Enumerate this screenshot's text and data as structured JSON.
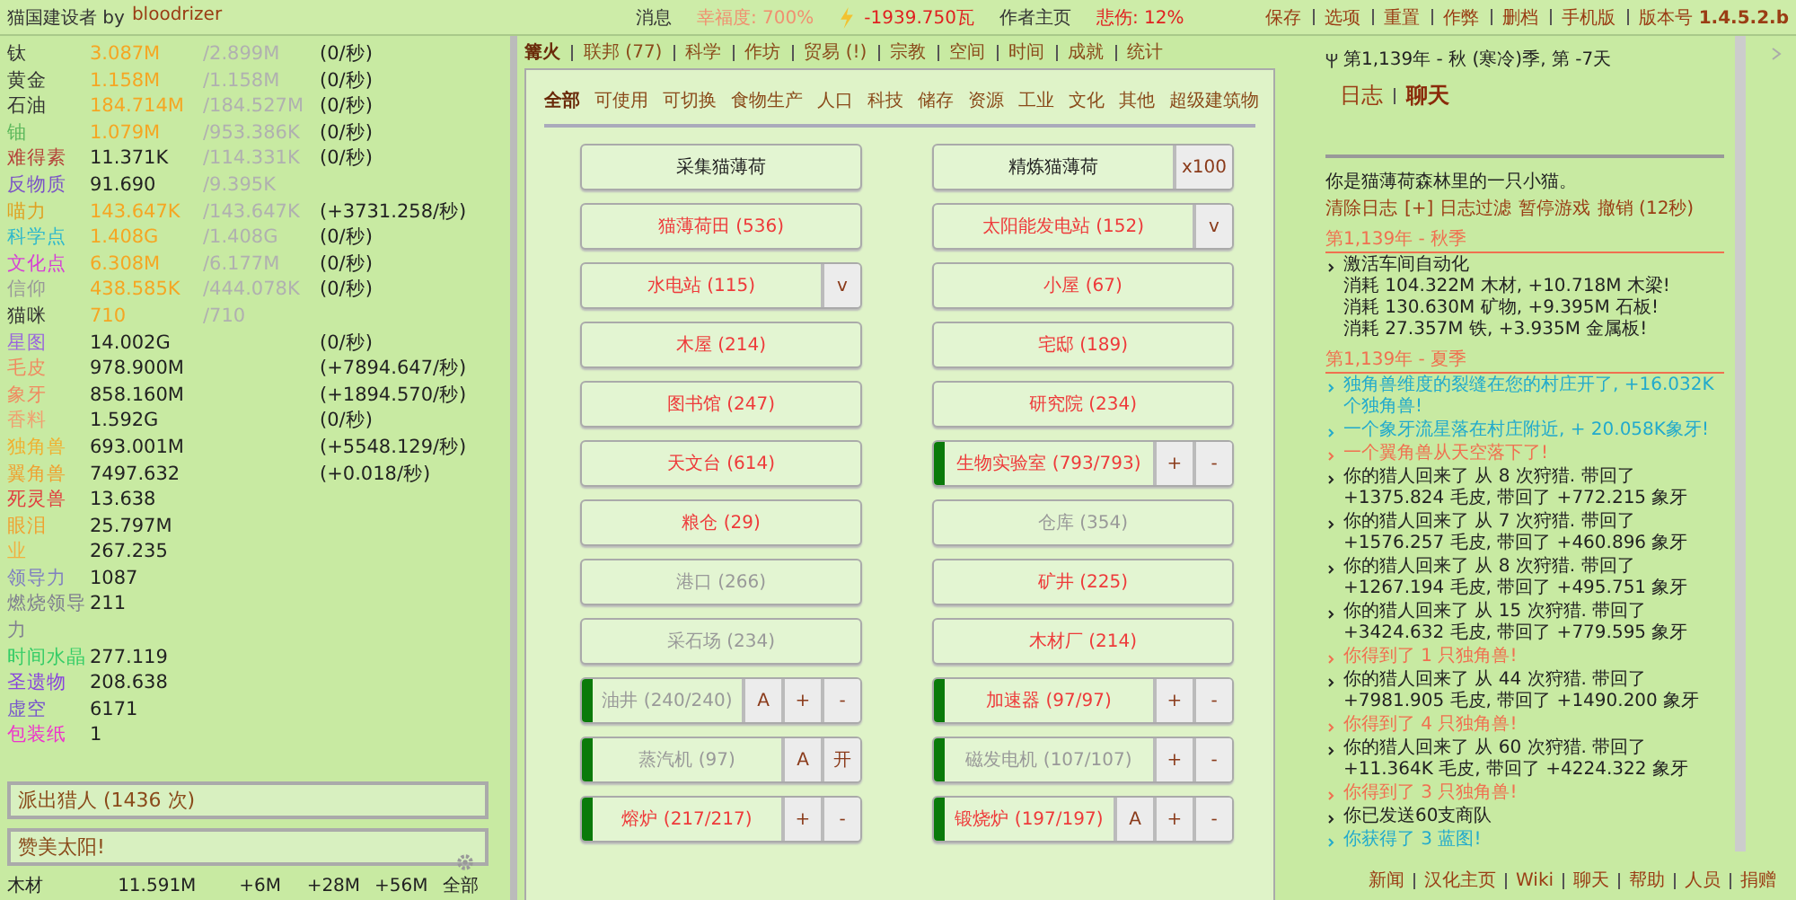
{
  "top_bar": {
    "title": "猫国建设者 by",
    "author": "bloodrizer",
    "center": [
      {
        "text": "消息",
        "color": "#333333"
      },
      {
        "text": "幸福度: 700%",
        "color": "#f09070"
      },
      {
        "text": "-1939.750瓦",
        "color": "#e02020",
        "icon": true
      },
      {
        "text": "作者主页",
        "color": "#333333"
      },
      {
        "text": "悲伤: 12%",
        "color": "#e02020"
      }
    ],
    "menu": [
      "保存",
      "选项",
      "重置",
      "作弊",
      "删档",
      "手机版"
    ],
    "version": "版本号 **1.4.5.2.b**"
  },
  "resources": [
    {
      "name": "钛",
      "color": "#333333",
      "amount": "3.087M",
      "capped": true,
      "max": "/2.899M",
      "rate": "(0/秒)"
    },
    {
      "name": "黄金",
      "color": "#333333",
      "amount": "1.158M",
      "capped": true,
      "max": "/1.158M",
      "rate": "(0/秒)"
    },
    {
      "name": "石油",
      "color": "#333333",
      "amount": "184.714M",
      "capped": true,
      "max": "/184.527M",
      "rate": "(0/秒)"
    },
    {
      "name": "铀",
      "color": "#5cb85c",
      "amount": "1.079M",
      "capped": true,
      "max": "/953.386K",
      "rate": "(0/秒)"
    },
    {
      "name": "难得素",
      "color": "#b5443a",
      "amount": "11.371K",
      "capped": false,
      "max": "/114.331K",
      "rate": "(0/秒)"
    },
    {
      "name": "反物质",
      "color": "#7a52c7",
      "amount": "91.690",
      "capped": false,
      "max": "/9.395K"
    },
    {
      "name": "喵力",
      "color": "#e0a020",
      "amount": "143.647K",
      "capped": true,
      "max": "/143.647K",
      "rate": "(+3731.258/秒)"
    },
    {
      "name": "科学点",
      "color": "#2fb8cc",
      "amount": "1.408G",
      "capped": true,
      "max": "/1.408G",
      "rate": "(0/秒)"
    },
    {
      "name": "文化点",
      "color": "#d63fd6",
      "amount": "6.308M",
      "capped": true,
      "max": "/6.177M",
      "rate": "(0/秒)"
    },
    {
      "name": "信仰",
      "color": "#999999",
      "amount": "438.585K",
      "capped": true,
      "max": "/444.078K",
      "rate": "(0/秒)"
    },
    {
      "name": "猫咪",
      "color": "#333333",
      "amount": "710",
      "capped": true,
      "max": "/710"
    },
    {
      "name": "星图",
      "color": "#9966dd",
      "amount": "14.002G",
      "capped": false,
      "rate": "(0/秒)"
    },
    {
      "name": "毛皮",
      "color": "#f08a60",
      "amount": "978.900M",
      "capped": false,
      "rate": "(+7894.647/秒)"
    },
    {
      "name": "象牙",
      "color": "#f08a60",
      "amount": "858.160M",
      "capped": false,
      "rate": "(+1894.570/秒)"
    },
    {
      "name": "香料",
      "color": "#f0a070",
      "amount": "1.592G",
      "capped": false,
      "rate": "(0/秒)"
    },
    {
      "name": "独角兽",
      "color": "#f0b030",
      "amount": "693.001M",
      "capped": false,
      "rate": "(+5548.129/秒)"
    },
    {
      "name": "翼角兽",
      "color": "#f0a030",
      "amount": "7497.632",
      "capped": false,
      "rate": "(+0.018/秒)"
    },
    {
      "name": "死灵兽",
      "color": "#e04040",
      "amount": "13.638",
      "capped": false
    },
    {
      "name": "眼泪",
      "color": "#f0a030",
      "amount": "25.797M",
      "capped": false
    },
    {
      "name": "业",
      "color": "#f0b040",
      "amount": "267.235",
      "capped": false
    },
    {
      "name": "领导力",
      "color": "#8080c0",
      "amount": "1087",
      "capped": false
    },
    {
      "name": "燃烧领导力",
      "color": "#808090",
      "amount": "211",
      "capped": false
    },
    {
      "name": "时间水晶",
      "color": "#33cc66",
      "amount": "277.119",
      "capped": false
    },
    {
      "name": "圣遗物",
      "color": "#8844dd",
      "amount": "208.638",
      "capped": false
    },
    {
      "name": "虚空",
      "color": "#7755cc",
      "amount": "6171",
      "capped": false
    },
    {
      "name": "包装纸",
      "color": "#ee33cc",
      "amount": "1",
      "capped": false
    }
  ],
  "actions": [
    "派出猎人 (1436 次)",
    "赞美太阳!"
  ],
  "craft_row": {
    "name": "木材",
    "amount": "11.591M",
    "buttons": [
      "+6M",
      "+28M",
      "+56M",
      "全部"
    ]
  },
  "tabs": [
    {
      "label": "篝火",
      "selected": true
    },
    {
      "label": "联邦 (77)",
      "selected": false
    },
    {
      "label": "科学",
      "selected": false
    },
    {
      "label": "作坊",
      "selected": false
    },
    {
      "label": "贸易 (!)",
      "selected": false
    },
    {
      "label": "宗教",
      "selected": false
    },
    {
      "label": "空间",
      "selected": false
    },
    {
      "label": "时间",
      "selected": false
    },
    {
      "label": "成就",
      "selected": false
    },
    {
      "label": "统计",
      "selected": false
    }
  ],
  "filters": [
    {
      "label": "全部",
      "selected": true
    },
    {
      "label": "可使用",
      "selected": false
    },
    {
      "label": "可切换",
      "selected": false
    },
    {
      "label": "食物生产",
      "selected": false
    },
    {
      "label": "人口",
      "selected": false
    },
    {
      "label": "科技",
      "selected": false
    },
    {
      "label": "储存",
      "selected": false
    },
    {
      "label": "资源",
      "selected": false
    },
    {
      "label": "工业",
      "selected": false
    },
    {
      "label": "文化",
      "selected": false
    },
    {
      "label": "其他",
      "selected": false
    },
    {
      "label": "超级建筑物",
      "selected": false
    }
  ],
  "buildings": [
    {
      "kind": "action",
      "label": "采集猫薄荷",
      "active": false
    },
    {
      "kind": "action",
      "label": "精炼猫薄荷",
      "active": false,
      "controls": [
        "x100"
      ]
    },
    {
      "kind": "building",
      "label": "猫薄荷田 (536)",
      "affordable": true,
      "active": false
    },
    {
      "kind": "building",
      "label": "太阳能发电站 (152)",
      "affordable": true,
      "active": false,
      "controls": [
        "v"
      ]
    },
    {
      "kind": "building",
      "label": "水电站 (115)",
      "affordable": true,
      "active": false,
      "controls": [
        "v"
      ]
    },
    {
      "kind": "building",
      "label": "小屋 (67)",
      "affordable": true,
      "active": false
    },
    {
      "kind": "building",
      "label": "木屋 (214)",
      "affordable": true,
      "active": false
    },
    {
      "kind": "building",
      "label": "宅邸 (189)",
      "affordable": true,
      "active": false
    },
    {
      "kind": "building",
      "label": "图书馆 (247)",
      "affordable": true,
      "active": false
    },
    {
      "kind": "building",
      "label": "研究院 (234)",
      "affordable": true,
      "active": false
    },
    {
      "kind": "building",
      "label": "天文台 (614)",
      "affordable": true,
      "active": false
    },
    {
      "kind": "building",
      "label": "生物实验室 (793/793)",
      "affordable": true,
      "active": true,
      "controls": [
        "+",
        "-"
      ]
    },
    {
      "kind": "building",
      "label": "粮仓 (29)",
      "affordable": true,
      "active": false
    },
    {
      "kind": "building",
      "label": "仓库 (354)",
      "affordable": false,
      "active": false
    },
    {
      "kind": "building",
      "label": "港口 (266)",
      "affordable": false,
      "active": false
    },
    {
      "kind": "building",
      "label": "矿井 (225)",
      "affordable": true,
      "active": false
    },
    {
      "kind": "building",
      "label": "采石场 (234)",
      "affordable": false,
      "active": false
    },
    {
      "kind": "building",
      "label": "木材厂 (214)",
      "affordable": true,
      "active": false
    },
    {
      "kind": "building",
      "label": "油井 (240/240)",
      "affordable": false,
      "active": true,
      "controls": [
        "A",
        "+",
        "-"
      ]
    },
    {
      "kind": "building",
      "label": "加速器 (97/97)",
      "affordable": true,
      "active": true,
      "controls": [
        "+",
        "-"
      ]
    },
    {
      "kind": "building",
      "label": "蒸汽机 (97)",
      "affordable": false,
      "active": true,
      "controls": [
        "A",
        "开"
      ]
    },
    {
      "kind": "building",
      "label": "磁发电机 (107/107)",
      "affordable": false,
      "active": true,
      "controls": [
        "+",
        "-"
      ]
    },
    {
      "kind": "building",
      "label": "熔炉 (217/217)",
      "affordable": true,
      "active": true,
      "controls": [
        "+",
        "-"
      ]
    },
    {
      "kind": "building",
      "label": "锻烧炉 (197/197)",
      "affordable": true,
      "active": true,
      "controls": [
        "A",
        "+",
        "-"
      ]
    }
  ],
  "log": {
    "date": "第1,139年 - 秋 (寒冷)季, 第 -7天",
    "tabs": [
      {
        "label": "日志",
        "selected": false
      },
      {
        "label": "聊天",
        "selected": true
      }
    ],
    "intro": "你是猫薄荷森林里的一只小猫。",
    "links": [
      "清除日志",
      "[+] 日志过滤",
      "暂停游戏",
      "撤销 (12秒)"
    ],
    "sections": [
      {
        "heading": "第1,139年 - 秋季",
        "entries": [
          {
            "color": "#222222",
            "lines": [
              "激活车间自动化",
              "消耗 104.322M 木材, +10.718M 木梁!",
              "消耗 130.630M 矿物, +9.395M 石板!",
              "消耗 27.357M 铁, +3.935M 金属板!"
            ]
          }
        ]
      },
      {
        "heading": "第1,139年 - 夏季",
        "entries": [
          {
            "color": "#22aacc",
            "lines": [
              "独角兽维度的裂缝在您的村庄开了, +16.032K个独角兽!"
            ]
          },
          {
            "color": "#22aacc",
            "lines": [
              "一个象牙流星落在村庄附近, + 20.058K象牙!"
            ]
          },
          {
            "color": "#f07050",
            "lines": [
              "一个翼角兽从天空落下了!"
            ]
          },
          {
            "color": "#222222",
            "lines": [
              "你的猎人回来了 从 8 次狩猎. 带回了 +1375.824 毛皮, 带回了 +772.215 象牙"
            ]
          },
          {
            "color": "#222222",
            "lines": [
              "你的猎人回来了 从 7 次狩猎. 带回了 +1576.257 毛皮, 带回了 +460.896 象牙"
            ]
          },
          {
            "color": "#222222",
            "lines": [
              "你的猎人回来了 从 8 次狩猎. 带回了 +1267.194 毛皮, 带回了 +495.751 象牙"
            ]
          },
          {
            "color": "#222222",
            "lines": [
              "你的猎人回来了 从 15 次狩猎. 带回了 +3424.632 毛皮, 带回了 +779.595 象牙"
            ]
          },
          {
            "color": "#f07050",
            "lines": [
              "你得到了 1 只独角兽!"
            ]
          },
          {
            "color": "#222222",
            "lines": [
              "你的猎人回来了 从 44 次狩猎. 带回了 +7981.905 毛皮, 带回了 +1490.200 象牙"
            ]
          },
          {
            "color": "#f07050",
            "lines": [
              "你得到了 4 只独角兽!"
            ]
          },
          {
            "color": "#222222",
            "lines": [
              "你的猎人回来了 从 60 次狩猎. 带回了 +11.364K 毛皮, 带回了 +4224.322 象牙"
            ]
          },
          {
            "color": "#f07050",
            "lines": [
              "你得到了 3 只独角兽!"
            ]
          },
          {
            "color": "#222222",
            "lines": [
              "你已发送60支商队"
            ]
          },
          {
            "color": "#22aacc",
            "lines": [
              "你获得了 3 蓝图!"
            ]
          }
        ]
      }
    ]
  },
  "footer": [
    "新闻",
    "汉化主页",
    "Wiki",
    "聊天",
    "帮助",
    "人员",
    "捐赠"
  ]
}
